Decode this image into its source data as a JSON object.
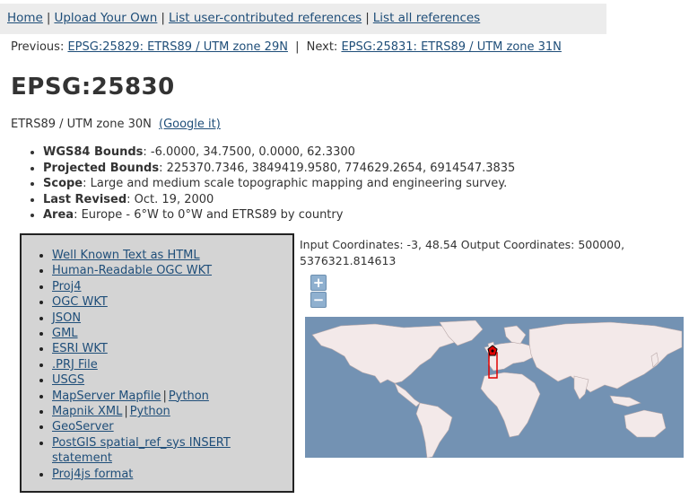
{
  "nav": {
    "home": "Home",
    "upload": "Upload Your Own",
    "user_refs": "List user-contributed references",
    "all_refs": "List all references",
    "sep": "|"
  },
  "prevnext": {
    "prev_label": "Previous:",
    "prev_link": "EPSG:25829: ETRS89 / UTM zone 29N",
    "next_label": "Next:",
    "next_link": "EPSG:25831: ETRS89 / UTM zone 31N"
  },
  "title": "EPSG:25830",
  "subtitle": {
    "name": "ETRS89 / UTM zone 30N",
    "google": "(Google it)"
  },
  "props": [
    {
      "key": "WGS84 Bounds",
      "value": ": -6.0000, 34.7500, 0.0000, 62.3300"
    },
    {
      "key": "Projected Bounds",
      "value": ": 225370.7346, 3849419.9580, 774629.2654, 6914547.3835"
    },
    {
      "key": "Scope",
      "value": ": Large and medium scale topographic mapping and engineering survey."
    },
    {
      "key": "Last Revised",
      "value": ": Oct. 19, 2000"
    },
    {
      "key": "Area",
      "value": ": Europe - 6°W to 0°W and ETRS89 by country"
    }
  ],
  "formats": {
    "wkt_html": "Well Known Text as HTML",
    "ogc_wkt_human": "Human-Readable OGC WKT",
    "proj4": "Proj4",
    "ogc_wkt": "OGC WKT",
    "json": "JSON",
    "gml": "GML",
    "esri_wkt": "ESRI WKT",
    "prj": ".PRJ File",
    "usgs": "USGS",
    "mapserver": "MapServer Mapfile",
    "python1": "Python",
    "mapnik": "Mapnik XML",
    "python2": "Python",
    "geoserver": "GeoServer",
    "postgis": "PostGIS spatial_ref_sys INSERT statement",
    "proj4js": "Proj4js format",
    "sep": "|"
  },
  "coords": "Input Coordinates: -3, 48.54 Output Coordinates: 500000, 5376321.814613",
  "zoom": {
    "in": "+",
    "out": "−"
  },
  "colors": {
    "ocean": "#7392b3",
    "land": "#f3e9e9",
    "bbox": "#e00000",
    "nav_bg": "#ececec",
    "panel_bg": "#d4d4d4"
  }
}
